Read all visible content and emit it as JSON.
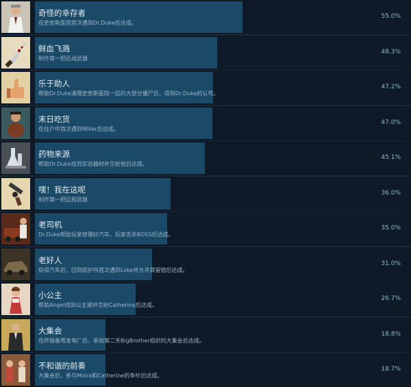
{
  "achievements": [
    {
      "title": "奇怪的幸存者",
      "description": "在史密斯医院首次遇到Dr.Duke后达成。",
      "percent_text": "55.0%",
      "percent": 55.0,
      "icon": "doctor-portrait-icon"
    },
    {
      "title": "鲜血飞溅",
      "description": "制作第一把近战武器",
      "percent_text": "48.3%",
      "percent": 48.3,
      "icon": "bloody-knife-icon"
    },
    {
      "title": "乐于助人",
      "description": "帮助Dr.Duke清理史密斯医院一层的大部分僵尸后，得到Dr.Duke的认可。",
      "percent_text": "47.2%",
      "percent": 47.2,
      "icon": "thumbs-up-icon"
    },
    {
      "title": "末日吃货",
      "description": "在住户中首次遇到Miller后达成。",
      "percent_text": "47.0%",
      "percent": 47.0,
      "icon": "chubby-survivor-icon"
    },
    {
      "title": "药物来源",
      "description": "帮助Dr.Duke找到实验器材并交给他后达成。",
      "percent_text": "45.1%",
      "percent": 45.1,
      "icon": "lab-equipment-icon"
    },
    {
      "title": "嘿！我在这呢",
      "description": "制作第一把远程武器",
      "percent_text": "36.0%",
      "percent": 36.0,
      "icon": "revolver-icon"
    },
    {
      "title": "老司机",
      "description": "Dr.Duke帮助玩家修理好汽车，玩家击杀BOSS后达成。",
      "percent_text": "35.0%",
      "percent": 35.0,
      "icon": "car-driver-icon"
    },
    {
      "title": "老好人",
      "description": "获得汽车后，回到庇护所首次遇到Loke并允许其留宿后达成。",
      "percent_text": "31.0%",
      "percent": 31.0,
      "icon": "old-car-icon"
    },
    {
      "title": "小公主",
      "description": "帮助Angel找到公主裙并交给Catherine后达成。",
      "percent_text": "26.7%",
      "percent": 26.7,
      "icon": "little-princess-icon"
    },
    {
      "title": "大集会",
      "description": "在炸毁备用发电厂后，参加第二天BigBrother组织的大集会后达成。",
      "percent_text": "18.8%",
      "percent": 18.8,
      "icon": "suited-man-icon"
    },
    {
      "title": "不和谐的前奏",
      "description": "大集会后，参与Moira和Catherine的争吵后达成。",
      "percent_text": "18.7%",
      "percent": 18.7,
      "icon": "arguing-pair-icon"
    }
  ]
}
